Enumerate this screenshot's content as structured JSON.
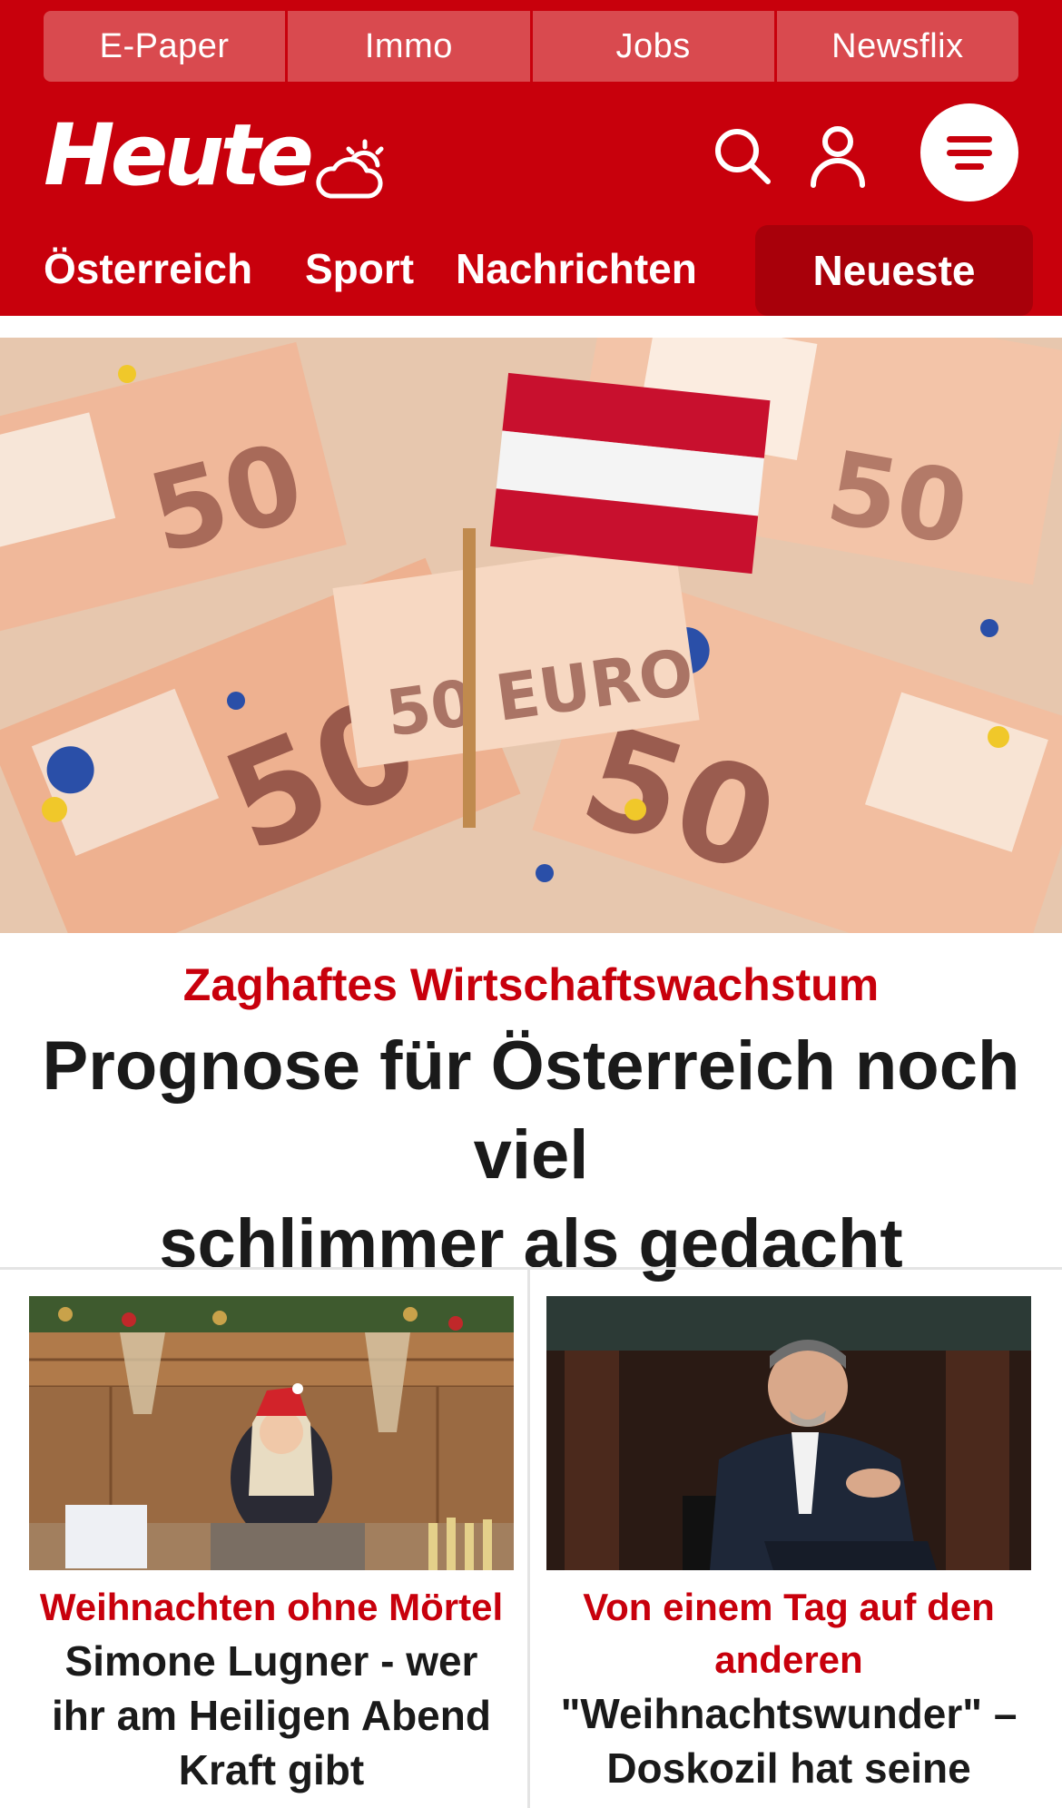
{
  "colors": {
    "brand_red": "#c8000c",
    "dark_red": "#a8000a",
    "top_link_bg": "#d94a4f",
    "text": "#1a1a1a"
  },
  "top_links": [
    "E-Paper",
    "Immo",
    "Jobs",
    "Newsflix"
  ],
  "brand": {
    "logo_text": "Heute",
    "icons": [
      "weather-cloud-sun-icon",
      "search-icon",
      "user-icon",
      "menu-icon"
    ]
  },
  "nav": {
    "items": [
      "Österreich",
      "Sport",
      "Nachrichten"
    ],
    "active": "Neueste"
  },
  "hero": {
    "kicker": "Zaghaftes Wirtschaftswachstum",
    "title_line1": "Prognose für Österreich noch viel",
    "title_line2": "schlimmer als gedacht"
  },
  "cards": [
    {
      "kicker": "Weihnachten ohne Mörtel",
      "title_lines": [
        "Simone Lugner - wer",
        "ihr am Heiligen Abend",
        "Kraft gibt"
      ]
    },
    {
      "kicker_lines": [
        "Von einem Tag auf den",
        "anderen"
      ],
      "title_lines": [
        "\"Weihnachtswunder\" –",
        "Doskozil hat seine"
      ]
    }
  ]
}
